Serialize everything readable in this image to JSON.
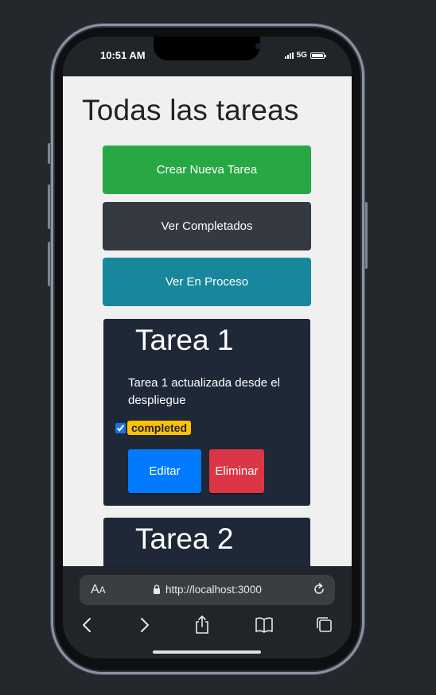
{
  "status_bar": {
    "time": "10:51 AM",
    "network": "5G"
  },
  "page": {
    "title": "Todas las tareas"
  },
  "actions": {
    "create_label": "Crear Nueva Tarea",
    "completed_label": "Ver Completados",
    "in_progress_label": "Ver En Proceso"
  },
  "tasks": [
    {
      "title": "Tarea 1",
      "description": "Tarea 1 actualizada desde el despliegue",
      "status": "completed",
      "checked": true,
      "edit_label": "Editar",
      "delete_label": "Eliminar"
    },
    {
      "title": "Tarea 2"
    }
  ],
  "browser": {
    "text_size_label": "AA",
    "url": "http://localhost:3000",
    "toolbar": [
      "back-icon",
      "forward-icon",
      "share-icon",
      "bookmarks-icon",
      "tabs-icon"
    ]
  },
  "colors": {
    "create": "#28a745",
    "completed_btn": "#343a40",
    "in_progress": "#17889b",
    "card": "#1f2837",
    "badge": "#ffc107",
    "edit": "#007bff",
    "delete": "#dc3545"
  }
}
